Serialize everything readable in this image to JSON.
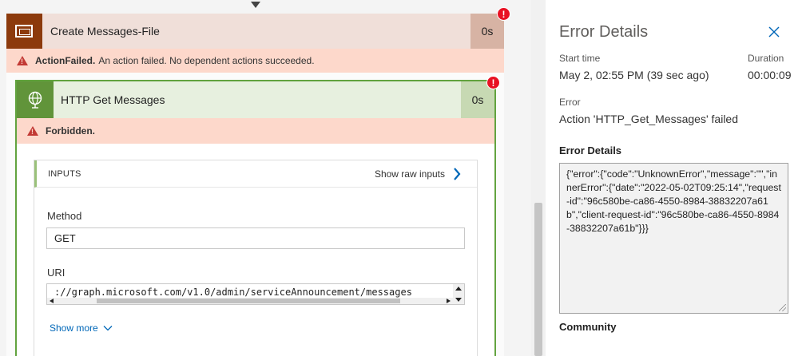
{
  "scope_action": {
    "title": "Create Messages-File",
    "duration": "0s",
    "error_badge": "!",
    "error_code": "ActionFailed.",
    "error_message": "An action failed. No dependent actions succeeded."
  },
  "http_action": {
    "title": "HTTP Get Messages",
    "duration": "0s",
    "error_badge": "!",
    "error_code": "Forbidden."
  },
  "inputs": {
    "section_label": "INPUTS",
    "show_raw_label": "Show raw inputs",
    "method_label": "Method",
    "method_value": "GET",
    "uri_label": "URI",
    "uri_value": "://graph.microsoft.com/v1.0/admin/serviceAnnouncement/messages",
    "show_more_label": "Show more"
  },
  "details": {
    "title": "Error Details",
    "start_time_label": "Start time",
    "start_time_value": "May 2, 02:55 PM (39 sec ago)",
    "duration_label": "Duration",
    "duration_value": "00:00:09",
    "error_label": "Error",
    "error_value": "Action 'HTTP_Get_Messages' failed",
    "error_details_heading": "Error Details",
    "error_details_text": "{\"error\":{\"code\":\"UnknownError\",\"message\":\"\",\"innerError\":{\"date\":\"2022-05-02T09:25:14\",\"request-id\":\"96c580be-ca86-4550-8984-38832207a61b\",\"client-request-id\":\"96c580be-ca86-4550-8984-38832207a61b\"}}}",
    "community_heading": "Community"
  },
  "colors": {
    "scope_icon_bg": "#8c3a0c",
    "http_icon_bg": "#61943a",
    "error_banner_bg": "#fdd8cb",
    "error_badge": "#e81123",
    "link": "#0067b8"
  },
  "icons": {
    "scope": "scope-frame-icon",
    "http": "globe-icon",
    "warning": "warning-triangle-icon",
    "close": "close-icon",
    "chevron_right": "chevron-right-icon",
    "chevron_down": "chevron-down-icon"
  }
}
